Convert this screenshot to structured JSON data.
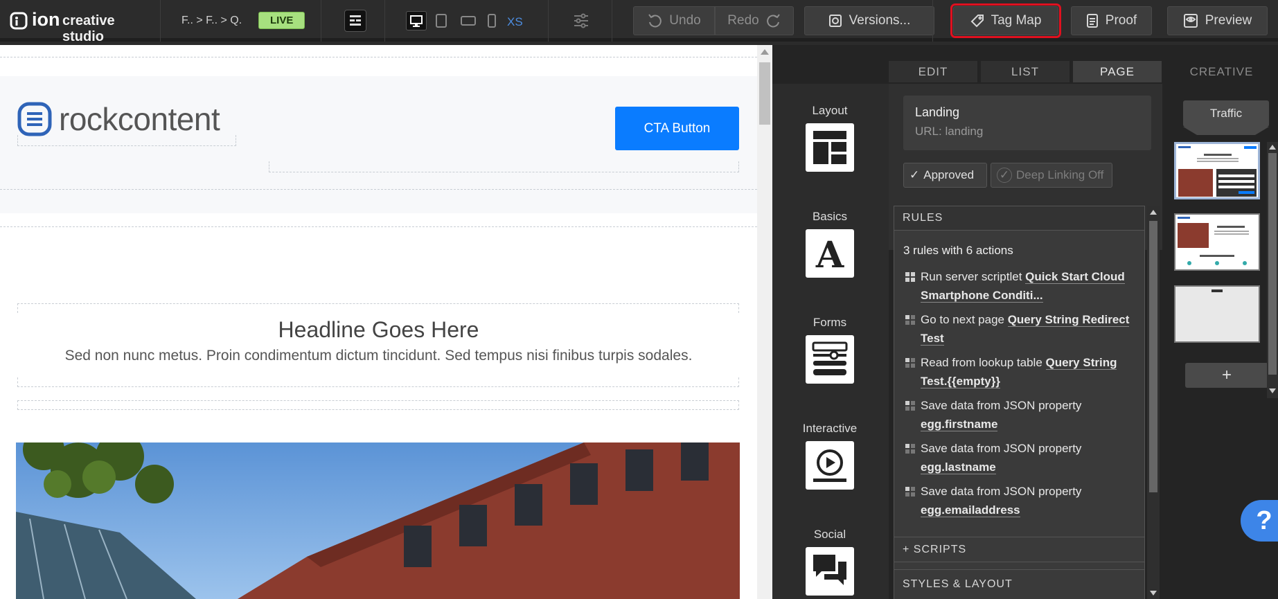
{
  "app": {
    "logo_text": "ion",
    "subtitle": "creative studio"
  },
  "topbar": {
    "breadcrumb": "F.. > F.. > Q.",
    "live_badge": "LIVE",
    "device_xs": "XS",
    "undo_label": "Undo",
    "redo_label": "Redo",
    "versions_label": "Versions...",
    "tagmap_label": "Tag Map",
    "proof_label": "Proof",
    "preview_label": "Preview"
  },
  "canvas": {
    "brand_name": "rockcontent",
    "cta_label": "CTA Button",
    "headline": "Headline Goes Here",
    "body_text": "Sed non nunc metus. Proin condimentum dictum tincidunt. Sed tempus nisi finibus turpis sodales."
  },
  "panel": {
    "tabs": [
      "EDIT",
      "LIST",
      "PAGE",
      "CREATIVE"
    ],
    "active_tab": "PAGE",
    "tools": [
      {
        "label": "Layout",
        "icon": "layout-icon"
      },
      {
        "label": "Basics",
        "icon": "text-icon"
      },
      {
        "label": "Forms",
        "icon": "form-icon"
      },
      {
        "label": "Interactive",
        "icon": "play-icon"
      },
      {
        "label": "Social",
        "icon": "chat-icon"
      }
    ],
    "page": {
      "name": "Landing",
      "url": "URL: landing",
      "approved_label": "Approved",
      "deeplink_label": "Deep Linking Off"
    },
    "rules_header": "RULES",
    "rules_summary": "3 rules with 6 actions",
    "rules": [
      {
        "text": "Run server scriptlet ",
        "link": "Quick Start Cloud Smartphone Conditi..."
      },
      {
        "text": "Go to next page ",
        "link": "Query String Redirect Test"
      },
      {
        "text": "Read from lookup table ",
        "link": "Query String Test.{{empty}}"
      },
      {
        "text": "Save data from JSON property ",
        "link": "egg.firstname"
      },
      {
        "text": "Save data from JSON property ",
        "link": "egg.lastname"
      },
      {
        "text": "Save data from JSON property ",
        "link": "egg.emailaddress"
      }
    ],
    "scripts_header": "+ SCRIPTS",
    "styles_header": "STYLES & LAYOUT",
    "traffic_label": "Traffic",
    "add_page_label": "+",
    "help_label": "?"
  },
  "colors": {
    "accent_blue": "#0a7cff",
    "live_green": "#a7e07f",
    "highlight_red": "#e0101f",
    "brand_blue": "#2f64b8"
  }
}
